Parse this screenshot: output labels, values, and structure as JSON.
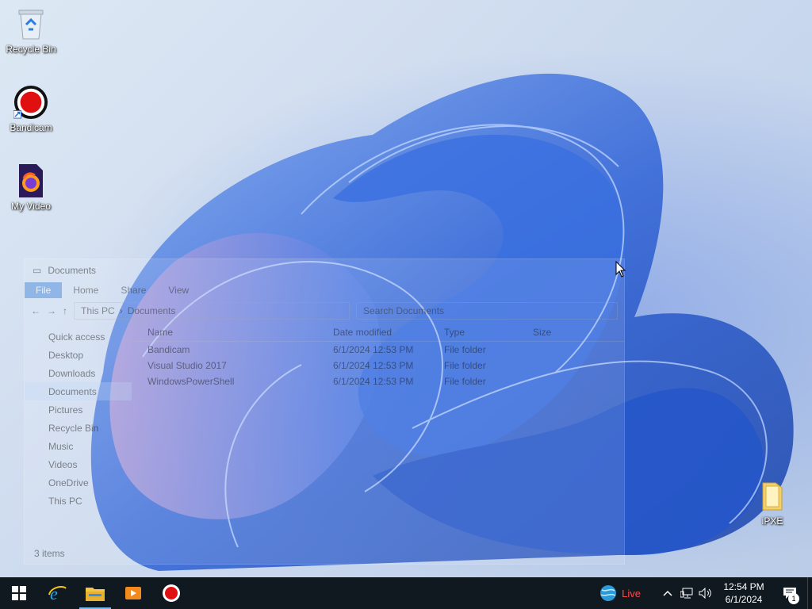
{
  "desktop": {
    "icons": [
      {
        "label": "Recycle Bin",
        "icon": "recycle-bin-icon"
      },
      {
        "label": "Bandicam",
        "icon": "bandicam-icon"
      },
      {
        "label": "My Video",
        "icon": "firefox-icon"
      },
      {
        "label": "iPXE",
        "icon": "folder-icon"
      }
    ]
  },
  "explorer": {
    "title": "Documents",
    "tabs": [
      "File",
      "Home",
      "Share",
      "View"
    ],
    "address": [
      "This PC",
      "Documents"
    ],
    "search_placeholder": "Search Documents",
    "nav": [
      "Quick access",
      "Desktop",
      "Downloads",
      "Documents",
      "Pictures",
      "Recycle Bin",
      "Music",
      "Videos",
      "OneDrive",
      "This PC"
    ],
    "columns": [
      "Name",
      "Date modified",
      "Type",
      "Size"
    ],
    "files": [
      {
        "name": "Bandicam",
        "date": "6/1/2024 12:53 PM",
        "type": "File folder",
        "size": ""
      },
      {
        "name": "Visual Studio 2017",
        "date": "6/1/2024 12:53 PM",
        "type": "File folder",
        "size": ""
      },
      {
        "name": "WindowsPowerShell",
        "date": "6/1/2024 12:53 PM",
        "type": "File folder",
        "size": ""
      }
    ],
    "status": "3 items"
  },
  "taskbar": {
    "apps": [
      "start-icon",
      "internet-explorer-icon",
      "file-explorer-icon",
      "media-player-icon",
      "bandicam-icon"
    ],
    "live_label": "Live",
    "time": "12:54 PM",
    "date": "6/1/2024",
    "notification_count": "1"
  },
  "colors": {
    "taskbar_bg": "#101820",
    "live_text": "#ff4a4a",
    "accent": "#76b9ed"
  }
}
